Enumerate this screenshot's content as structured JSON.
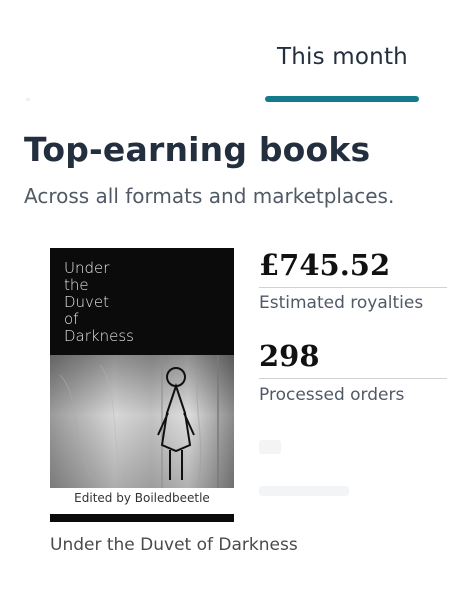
{
  "tabs": {
    "faded_label": "",
    "active_label": "This month"
  },
  "section": {
    "title": "Top-earning books",
    "subtitle": "Across all formats and marketplaces."
  },
  "book": {
    "cover_title_lines": [
      "Under",
      "the",
      "Duvet",
      "of",
      "Darkness"
    ],
    "cover_credit": "Edited by Boiledbeetle",
    "title": "Under the Duvet of Darkness"
  },
  "metrics": {
    "royalties_value": "£745.52",
    "royalties_label": "Estimated royalties",
    "orders_value": "298",
    "orders_label": "Processed orders"
  },
  "colors": {
    "accent": "#147b8c",
    "heading": "#232f3e",
    "muted": "#505a66"
  }
}
